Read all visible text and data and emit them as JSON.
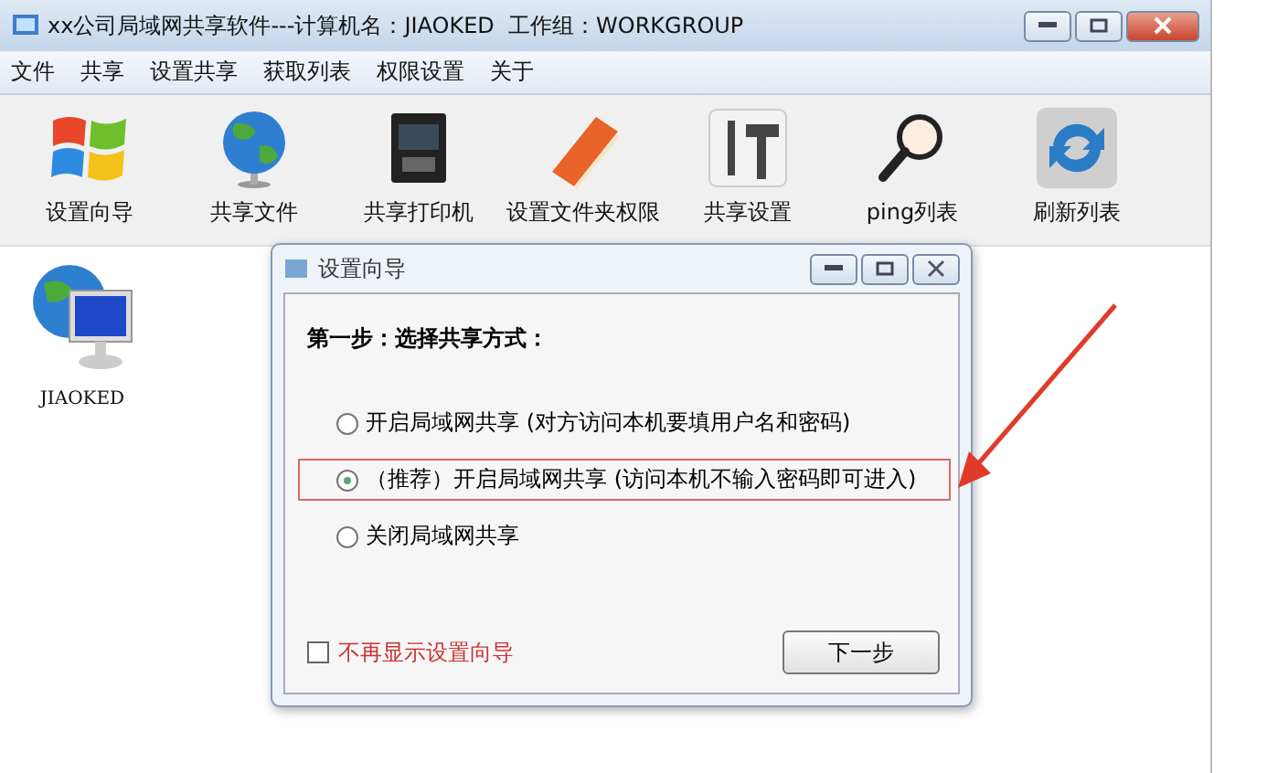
{
  "window": {
    "title": "xx公司局域网共享软件---计算机名：JIAOKED  工作组：WORKGROUP"
  },
  "menu": [
    "文件",
    "共享",
    "设置共享",
    "获取列表",
    "权限设置",
    "关于"
  ],
  "toolbar": [
    {
      "label": "设置向导"
    },
    {
      "label": "共享文件"
    },
    {
      "label": "共享打印机"
    },
    {
      "label": "设置文件夹权限"
    },
    {
      "label": "共享设置"
    },
    {
      "label": "ping列表"
    },
    {
      "label": "刷新列表"
    }
  ],
  "computers": [
    {
      "label": "JIAOKED"
    }
  ],
  "dialog": {
    "title": "设置向导",
    "heading": "第一步：选择共享方式：",
    "options": [
      {
        "label": "开启局域网共享 (对方访问本机要填用户名和密码)",
        "selected": false,
        "highlighted": false
      },
      {
        "label": "（推荐）开启局域网共享 (访问本机不输入密码即可进入)",
        "selected": true,
        "highlighted": true
      },
      {
        "label": "关闭局域网共享",
        "selected": false,
        "highlighted": false
      }
    ],
    "dont_show": {
      "label": "不再显示设置向导",
      "checked": false
    },
    "next_button": "下一步"
  }
}
